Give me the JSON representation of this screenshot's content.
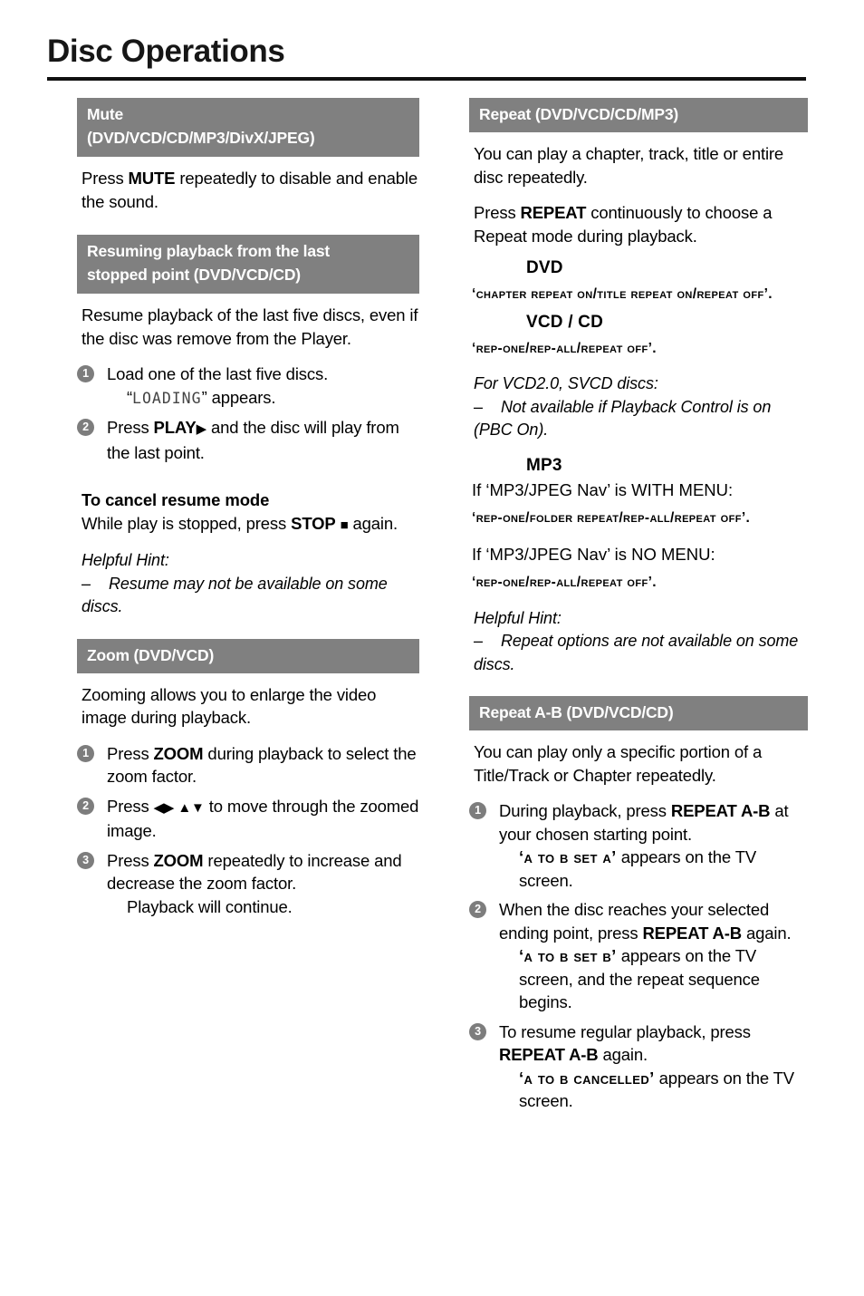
{
  "page": {
    "title": "Disc Operations",
    "accent_gray": "#808080",
    "bullet_gray": "#7d7d7d",
    "rule_color": "#111111"
  },
  "left_column": {
    "sections": [
      {
        "id": "mute",
        "header_line1": "Mute",
        "header_line2": "(DVD/VCD/CD/MP3/DivX/JPEG)",
        "body_pre": "Press ",
        "body_bold": "MUTE",
        "body_post": " repeatedly to disable and enable the sound."
      },
      {
        "id": "resume",
        "header_line1": "Resuming playback from the last",
        "header_line2": "stopped point (DVD/VCD/CD)",
        "intro": "Resume playback of the last five discs, even if the disc was remove from the Player.",
        "step1_num": "1",
        "step1_text": "Load one of the last five discs.",
        "step1_lcd_open": "“",
        "step1_lcd": "LOADING",
        "step1_lcd_close": "” appears.",
        "step2_num": "2",
        "step2_pre": "Press ",
        "step2_bold": "PLAY",
        "step2_arrow": "▶",
        "step2_post": " and the disc will play from the last point.",
        "cancel_head": "To cancel resume mode",
        "cancel_pre": "While play is stopped, press ",
        "cancel_bold": "STOP",
        "cancel_stop_glyph": "■",
        "cancel_post": " again.",
        "hint_label": "Helpful Hint:",
        "hint_dash": "–",
        "hint_text": "Resume may not be available on some discs."
      },
      {
        "id": "zoom",
        "header_line1": "Zoom (DVD/VCD)",
        "intro": "Zooming allows you to enlarge the video image during playback.",
        "step1_num": "1",
        "step1_pre": "Press ",
        "step1_bold": "ZOOM",
        "step1_post": " during playback to select the zoom factor.",
        "step2_num": "2",
        "step2_pre": "Press ",
        "step2_arrows": "◀▶ ▲▼",
        "step2_post": " to move through the zoomed image.",
        "step3_num": "3",
        "step3_pre": "Press ",
        "step3_bold": "ZOOM",
        "step3_post": " repeatedly to increase and decrease the zoom factor.",
        "step3_sub": "Playback will continue."
      }
    ]
  },
  "right_column": {
    "sections": [
      {
        "id": "repeat",
        "header_line1": "Repeat (DVD/VCD/CD/MP3)",
        "intro": "You can play a chapter, track, title or entire disc repeatedly.",
        "press_pre": "Press ",
        "press_bold": "REPEAT",
        "press_post": " continuously to choose a Repeat mode during playback.",
        "dvd_label": "DVD",
        "dvd_osd": "‘CHAPTER REPEAT ON/TITLE REPEAT ON/REPEAT OFF’.",
        "vcdcd_label": "VCD / CD",
        "vcdcd_osd": "‘REP-ONE/REP-ALL/REPEAT OFF’.",
        "vcd2_label": "For VCD2.0, SVCD discs:",
        "vcd2_dash": "–",
        "vcd2_text": "Not available if Playback Control is on (PBC On).",
        "mp3_label": "MP3",
        "mp3_with_menu": "If ‘MP3/JPEG Nav’ is WITH MENU:",
        "mp3_with_menu_osd": "‘REP-ONE/FOLDER REPEAT/REP-ALL/REPEAT OFF’.",
        "mp3_no_menu": "If ‘MP3/JPEG Nav’ is NO MENU:",
        "mp3_no_menu_osd": "‘REP-ONE/REP-ALL/REPEAT OFF’.",
        "hint_label": "Helpful Hint:",
        "hint_dash": "–",
        "hint_text": "Repeat options are not available on some discs."
      },
      {
        "id": "repeat-ab",
        "header_line1": "Repeat A-B (DVD/VCD/CD)",
        "intro": "You can play only a specific portion of a Title/Track or Chapter repeatedly.",
        "step1_num": "1",
        "step1_pre": "During playback, press ",
        "step1_bold": "REPEAT A-B",
        "step1_post": " at your chosen starting point.",
        "step1_osd": "‘A TO B  SET A’",
        "step1_osd_post": " appears on the TV screen.",
        "step2_num": "2",
        "step2_pre": "When the disc reaches your selected ending point, press ",
        "step2_bold": "REPEAT A-B",
        "step2_post": " again.",
        "step2_osd": "‘A TO B  SET B’",
        "step2_osd_post": " appears on the TV screen, and the repeat sequence begins.",
        "step3_num": "3",
        "step3_pre": "To resume regular playback, press ",
        "step3_bold": "REPEAT A-B",
        "step3_post": " again.",
        "step3_osd": "‘A TO B  CANCELLED’",
        "step3_osd_post": " appears on the TV screen."
      }
    ]
  }
}
